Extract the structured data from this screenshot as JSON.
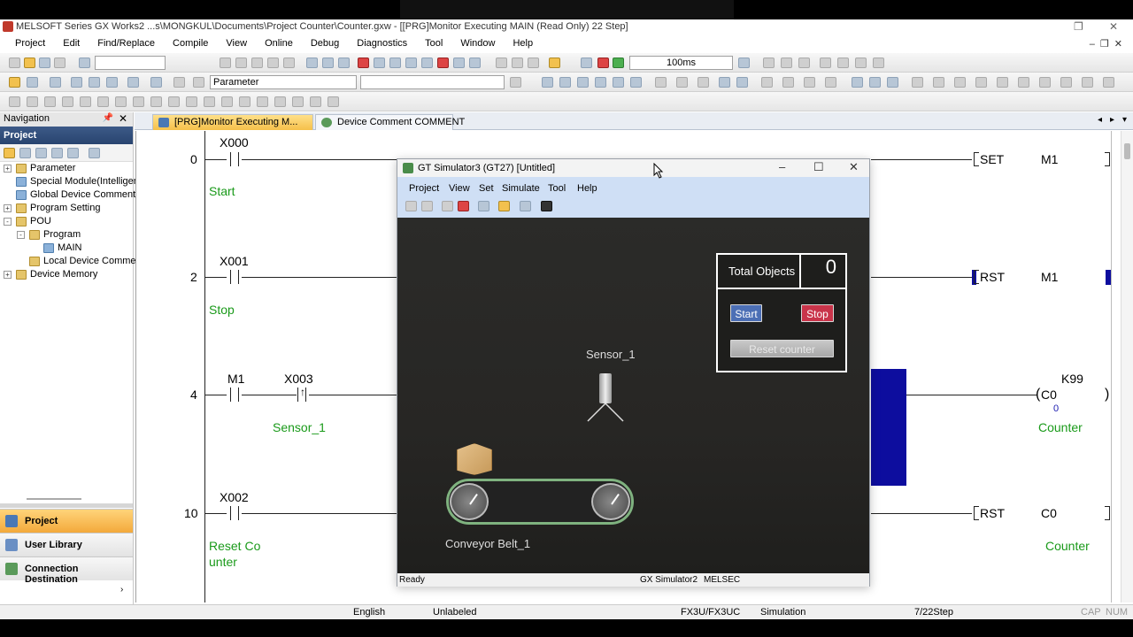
{
  "app": {
    "title": "MELSOFT Series GX Works2 ...s\\MONGKUL\\Documents\\Project Counter\\Counter.gxw - [[PRG]Monitor Executing MAIN (Read Only) 22 Step]",
    "menu": [
      "Project",
      "Edit",
      "Find/Replace",
      "Compile",
      "View",
      "Online",
      "Debug",
      "Diagnostics",
      "Tool",
      "Window",
      "Help"
    ],
    "toolbar": {
      "interval": "100ms",
      "parameter_combo": "Parameter"
    }
  },
  "navigation": {
    "header": "Navigation",
    "section": "Project",
    "tree": [
      {
        "label": "Parameter",
        "level": 0,
        "expander": "+"
      },
      {
        "label": "Special Module(Intelligent",
        "level": 0,
        "expander": ""
      },
      {
        "label": "Global Device Comment",
        "level": 0,
        "expander": ""
      },
      {
        "label": "Program Setting",
        "level": 0,
        "expander": "+"
      },
      {
        "label": "POU",
        "level": 0,
        "expander": "-"
      },
      {
        "label": "Program",
        "level": 1,
        "expander": "-"
      },
      {
        "label": "MAIN",
        "level": 2,
        "expander": ""
      },
      {
        "label": "Local Device Commen",
        "level": 1,
        "expander": ""
      },
      {
        "label": "Device Memory",
        "level": 0,
        "expander": "+"
      }
    ],
    "buttons": [
      "Project",
      "User Library",
      "Connection Destination"
    ]
  },
  "tabs": [
    "[PRG]Monitor Executing M...",
    "Device Comment COMMENT"
  ],
  "ladder": {
    "rungs": [
      {
        "step": "0",
        "device": "X000",
        "comment": "Start",
        "instr": "SET",
        "operand": "M1"
      },
      {
        "step": "2",
        "device": "X001",
        "comment": "Stop",
        "instr": "RST",
        "operand": "M1"
      },
      {
        "step": "4",
        "device": "M1",
        "device2": "X003",
        "comment2": "Sensor_1",
        "coil": "C0",
        "const": "K99",
        "value": "0",
        "coil_comment": "Counter"
      },
      {
        "step": "10",
        "device": "X002",
        "comment_line1": "Reset Co",
        "comment_line2": "unter",
        "instr": "RST",
        "operand": "C0",
        "operand_comment": "Counter"
      }
    ]
  },
  "gt_sim": {
    "title": "GT Simulator3 (GT27)  [Untitled]",
    "menu": [
      "Project",
      "View",
      "Set",
      "Simulate",
      "Tool",
      "Help"
    ],
    "panel": {
      "label": "Total Objects",
      "count": "0",
      "start": "Start",
      "stop": "Stop",
      "reset": "Reset counter"
    },
    "sensor_label": "Sensor_1",
    "conveyor_label": "Conveyor Belt_1",
    "status": {
      "left": "Ready",
      "mid": "GX Simulator2",
      "right": "MELSEC"
    },
    "colors": {
      "start_btn": "#4c6fb5",
      "stop_btn": "#c9344a",
      "belt": "#7fb27f"
    }
  },
  "status": {
    "lang": "English",
    "label": "Unlabeled",
    "cpu": "FX3U/FX3UC",
    "mode": "Simulation",
    "step": "7/22Step",
    "caps": "CAP",
    "num": "NUM"
  }
}
